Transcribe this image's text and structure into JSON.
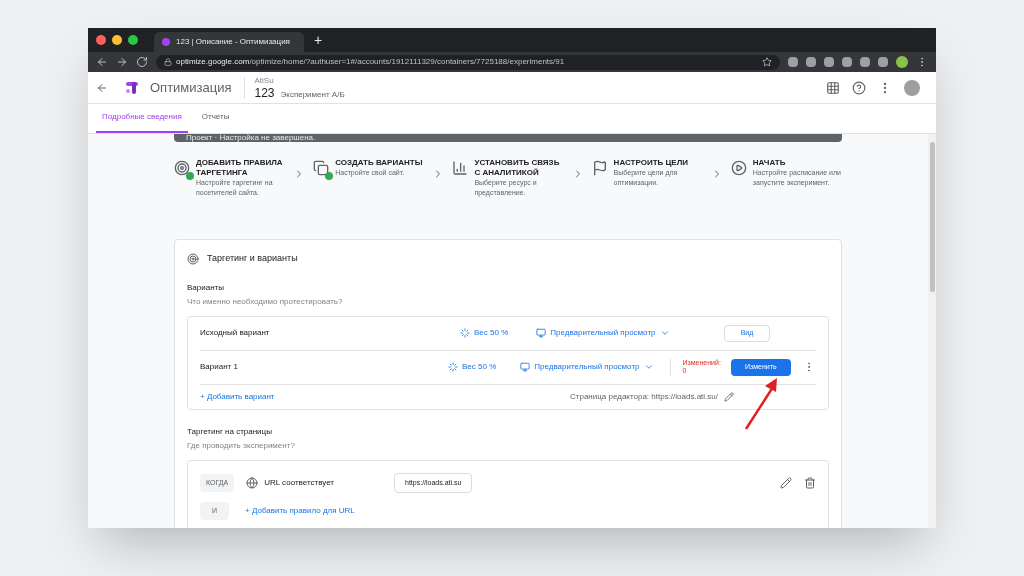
{
  "browser": {
    "tab_title": "123 | Описание - Оптимизация",
    "new_tab": "+",
    "url_host": "optimize.google.com",
    "url_path": "/optimize/home/?authuser=1#/accounts/1912111329/containers/7725188/experiments/91"
  },
  "header": {
    "product": "Оптимизация",
    "account": "AtiSu",
    "experiment_name": "123",
    "experiment_type": "Эксперимент А/Б"
  },
  "tabs": [
    {
      "label": "Подробные сведения",
      "selected": true
    },
    {
      "label": "Отчеты",
      "selected": false
    }
  ],
  "banner": {
    "text": "Проект · Настройка не завершена."
  },
  "steps": [
    {
      "title": "ДОБАВИТЬ ПРАВИЛА ТАРГЕТИНГА",
      "text": "Настройте таргетинг на посетителей сайта.",
      "done": true,
      "kind": "target"
    },
    {
      "title": "СОЗДАТЬ ВАРИАНТЫ",
      "text": "Настройте свой сайт.",
      "done": true,
      "kind": "variants"
    },
    {
      "title": "УСТАНОВИТЬ СВЯЗЬ С АНАЛИТИКОЙ",
      "text": "Выберите ресурс и представление.",
      "done": false,
      "kind": "analytics"
    },
    {
      "title": "НАСТРОИТЬ ЦЕЛИ",
      "text": "Выберите цели для оптимизации.",
      "done": false,
      "kind": "goals"
    },
    {
      "title": "НАЧАТЬ",
      "text": "Настройте расписание или запустите эксперимент.",
      "done": false,
      "kind": "start"
    }
  ],
  "card": {
    "title": "Таргетинг и варианты",
    "variants_heading": "Варианты",
    "variants_hint": "Что именно необходимо протестировать?",
    "variants": [
      {
        "name": "Исходный вариант",
        "weight": "Вес 50 %",
        "preview": "Предварительный просмотр",
        "kind": "original",
        "action": "Вид"
      },
      {
        "name": "Вариант 1",
        "weight": "Вес 50 %",
        "preview": "Предварительный просмотр",
        "kind": "variant",
        "changes_label": "Изменений:",
        "changes_count": "0",
        "action": "Изменить"
      }
    ],
    "add_variant": "+ Добавить вариант",
    "editor_page": "Страница редактора: https://loads.ati.su/",
    "targeting_heading": "Таргетинг на страницы",
    "targeting_hint": "Где проводить эксперимент?",
    "rule": {
      "when": "КОГДА",
      "condition": "URL соответствует",
      "value": "https://loads.ati.su"
    },
    "and": "И",
    "add_rule": "+ Добавить правило для URL"
  }
}
